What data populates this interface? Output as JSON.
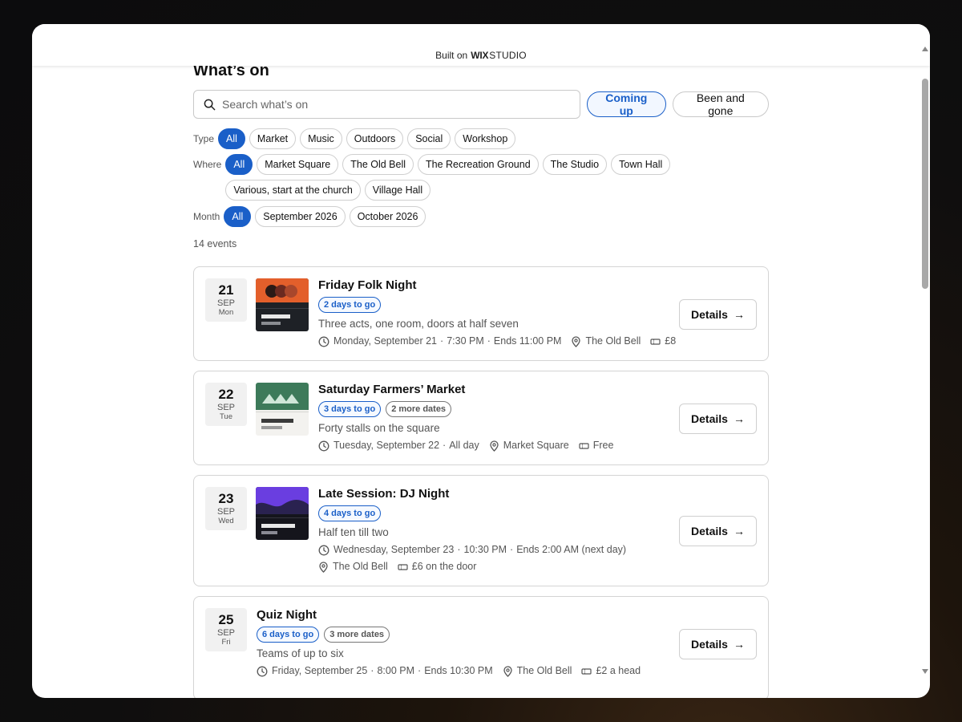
{
  "topbar": {
    "built_on": "Built on",
    "brand": "WIX",
    "brand_suffix": "STUDIO"
  },
  "page": {
    "title": "What’s on"
  },
  "search": {
    "placeholder": "Search what’s on",
    "value": ""
  },
  "timeframe": {
    "coming_up": "Coming up",
    "been_and_gone": "Been and gone",
    "selected": "Coming up"
  },
  "filters": {
    "type": {
      "label": "Type",
      "options": [
        "All",
        "Market",
        "Music",
        "Outdoors",
        "Social",
        "Workshop"
      ],
      "selected": "All"
    },
    "where": {
      "label": "Where",
      "options": [
        "All",
        "Market Square",
        "The Old Bell",
        "The Recreation Ground",
        "The Studio",
        "Town Hall",
        "Various, start at the church",
        "Village Hall"
      ],
      "selected": "All"
    },
    "month": {
      "label": "Month",
      "options": [
        "All",
        "September 2026",
        "October 2026"
      ],
      "selected": "All"
    }
  },
  "results": {
    "count_text": "14 events"
  },
  "details_label": "Details",
  "colors": {
    "accent": "#1a5fc8"
  },
  "events": [
    {
      "day": "21",
      "month": "SEP",
      "weekday": "Mon",
      "title": "Friday Folk Night",
      "tag_primary": "2 days to go",
      "tag_secondary": "",
      "description": "Three acts, one room, doors at half seven",
      "datetime": "Monday, September 21",
      "time": "7:30 PM",
      "ends": "Ends 11:00 PM",
      "venue": "The Old Bell",
      "price": "£8",
      "thumb": "folk"
    },
    {
      "day": "22",
      "month": "SEP",
      "weekday": "Tue",
      "title": "Saturday Farmers’ Market",
      "tag_primary": "3 days to go",
      "tag_secondary": "2 more dates",
      "description": "Forty stalls on the square",
      "datetime": "Tuesday, September 22",
      "time": "All day",
      "ends": "",
      "venue": "Market Square",
      "price": "Free",
      "thumb": "market"
    },
    {
      "day": "23",
      "month": "SEP",
      "weekday": "Wed",
      "title": "Late Session: DJ Night",
      "tag_primary": "4 days to go",
      "tag_secondary": "",
      "description": "Half ten till two",
      "datetime": "Wednesday, September 23",
      "time": "10:30 PM",
      "ends": "Ends 2:00 AM (next day)",
      "venue": "The Old Bell",
      "price": "£6 on the door",
      "thumb": "dj"
    },
    {
      "day": "25",
      "month": "SEP",
      "weekday": "Fri",
      "title": "Quiz Night",
      "tag_primary": "6 days to go",
      "tag_secondary": "3 more dates",
      "description": "Teams of up to six",
      "datetime": "Friday, September 25",
      "time": "8:00 PM",
      "ends": "Ends 10:30 PM",
      "venue": "The Old Bell",
      "price": "£2 a head",
      "thumb": ""
    }
  ]
}
